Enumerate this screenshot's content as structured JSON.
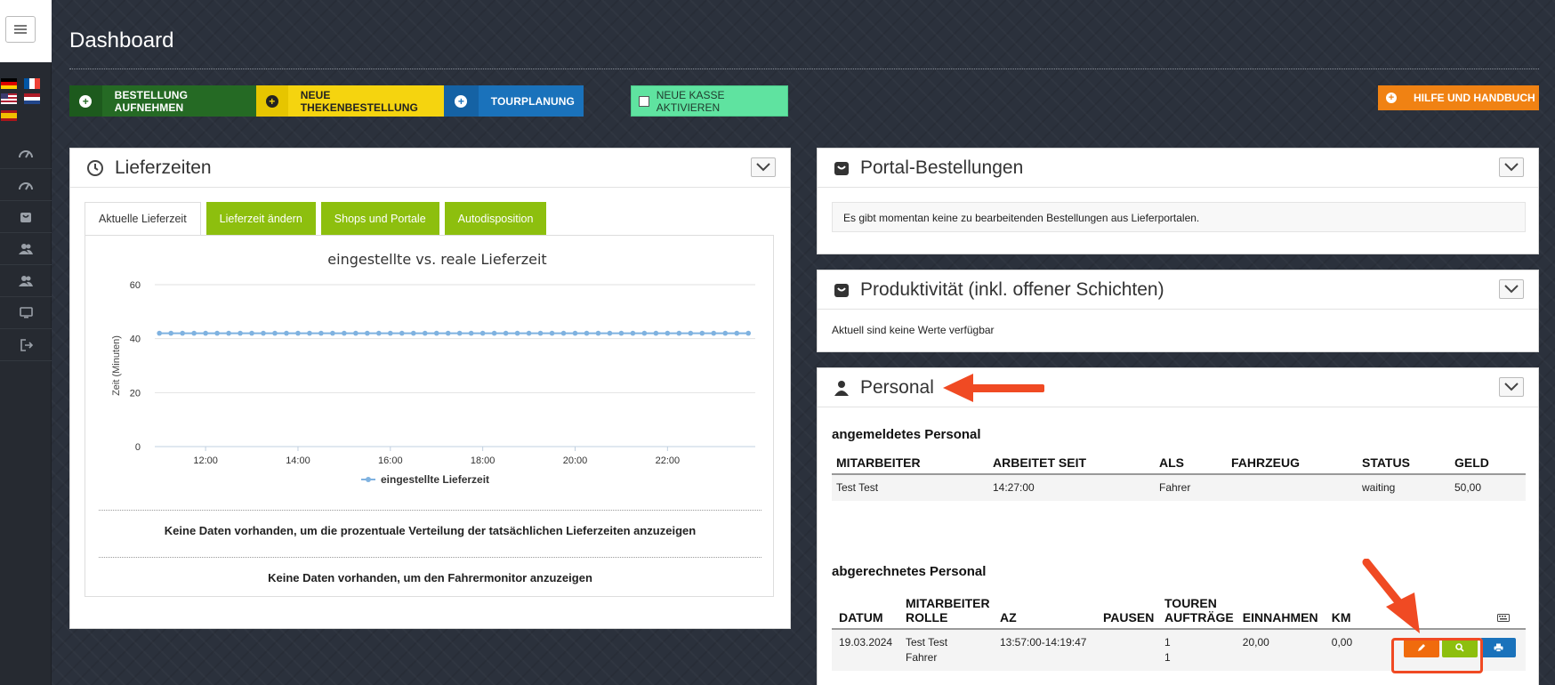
{
  "page": {
    "title": "Dashboard"
  },
  "toolbar": {
    "bestellung": "BESTELLUNG AUFNEHMEN",
    "theke": "NEUE THEKENBESTELLUNG",
    "tour": "TOURPLANUNG",
    "kasse": "NEUE KASSE AKTIVIEREN",
    "hilfe": "HILFE UND HANDBUCH"
  },
  "colors": {
    "green": "#256a24",
    "yellow": "#f5d40f",
    "blue": "#1a72bb",
    "mint": "#5fe3a0",
    "orange": "#f08213",
    "tab_green": "#8dbf0e",
    "series": "#7fb2e0",
    "annotation_red": "#f04a23"
  },
  "lieferzeiten": {
    "title": "Lieferzeiten",
    "tabs": [
      "Aktuelle Lieferzeit",
      "Lieferzeit ändern",
      "Shops und Portale",
      "Autodisposition"
    ],
    "no_data_1": "Keine Daten vorhanden, um die prozentuale Verteilung der tatsächlichen Lieferzeiten anzuzeigen",
    "no_data_2": "Keine Daten vorhanden, um den Fahrermonitor anzuzeigen"
  },
  "chart_data": {
    "type": "line",
    "title": "eingestellte vs. reale Lieferzeit",
    "ylabel": "Zeit (Minuten)",
    "xlabel": "",
    "ylim": [
      0,
      60
    ],
    "yticks": [
      0,
      20,
      40,
      60
    ],
    "xlim": [
      10.9,
      23.9
    ],
    "xticks": [
      "12:00",
      "14:00",
      "16:00",
      "18:00",
      "20:00",
      "22:00"
    ],
    "xtick_values": [
      12,
      14,
      16,
      18,
      20,
      22
    ],
    "legend": "bottom",
    "grid": true,
    "series": [
      {
        "name": "eingestellte Lieferzeit",
        "x_start": 11.0,
        "x_end": 23.8,
        "x_step": 0.25,
        "constant_value": 42
      }
    ]
  },
  "portal": {
    "title": "Portal-Bestellungen",
    "message": "Es gibt momentan keine zu bearbeitenden Bestellungen aus Lieferportalen."
  },
  "produktivitaet": {
    "title": "Produktivität (inkl. offener Schichten)",
    "message": "Aktuell sind keine Werte verfügbar"
  },
  "personal": {
    "title": "Personal",
    "angemeldet_title": "angemeldetes Personal",
    "angemeldet_headers": [
      "MITARBEITER",
      "ARBEITET SEIT",
      "ALS",
      "FAHRZEUG",
      "STATUS",
      "GELD"
    ],
    "angemeldet_rows": [
      [
        "Test Test",
        "14:27:00",
        "Fahrer",
        "",
        "waiting",
        "50,00"
      ]
    ],
    "abgerechnet_title": "abgerechnetes Personal",
    "abgerechnet_headers": {
      "datum": "DATUM",
      "mitarbeiter": "MITARBEITER",
      "rolle": "ROLLE",
      "az": "AZ",
      "pausen": "PAUSEN",
      "touren": "TOUREN",
      "auftraege": "AUFTRÄGE",
      "einnahmen": "EINNAHMEN",
      "km": "KM"
    },
    "abgerechnet_row": {
      "datum": "19.03.2024",
      "mitarbeiter": "Test Test",
      "rolle": "Fahrer",
      "az": "13:57:00-14:19:47",
      "pausen": "",
      "touren": "1",
      "auftraege": "1",
      "einnahmen": "20,00",
      "km": "0,00"
    }
  },
  "sidebar": {
    "icons": [
      "dashboard-icon",
      "dashboard-icon",
      "shop-icon",
      "users-icon",
      "users-icon",
      "monitor-icon",
      "logout-icon"
    ]
  }
}
